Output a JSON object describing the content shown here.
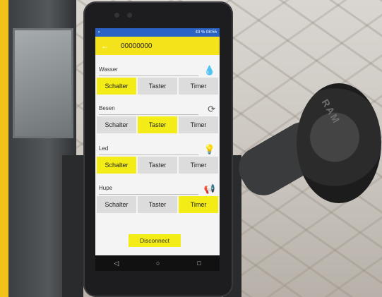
{
  "statusbar": {
    "right": "43 % 08:55"
  },
  "app": {
    "title": "00000000"
  },
  "sections": [
    {
      "label": "Wasser",
      "icon": "water-drop-icon",
      "glyph": "💧",
      "buttons": [
        "Schalter",
        "Taster",
        "Timer"
      ],
      "active": 0
    },
    {
      "label": "Besen",
      "icon": "refresh-icon",
      "glyph": "⟳",
      "buttons": [
        "Schalter",
        "Taster",
        "Timer"
      ],
      "active": 1
    },
    {
      "label": "Led",
      "icon": "light-bulb-icon",
      "glyph": "💡",
      "buttons": [
        "Schalter",
        "Taster",
        "Timer"
      ],
      "active": 0
    },
    {
      "label": "Hupe",
      "icon": "horn-icon",
      "glyph": "📢",
      "buttons": [
        "Schalter",
        "Taster",
        "Timer"
      ],
      "active": 2
    }
  ],
  "disconnect_label": "Disconnect",
  "navbar": {
    "back": "◁",
    "home": "○",
    "recent": "□"
  },
  "mount_brand": "RAM",
  "colors": {
    "accent": "#f4ec17",
    "statusbar": "#2b63c4",
    "button": "#dcdcdc"
  }
}
